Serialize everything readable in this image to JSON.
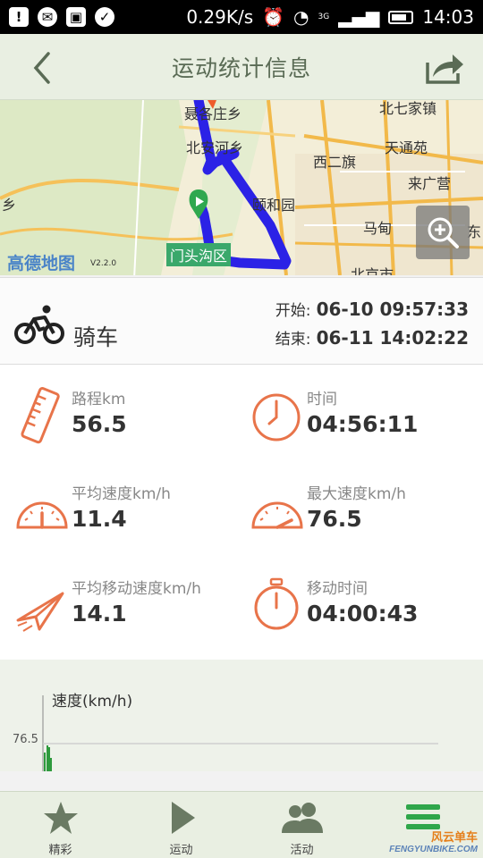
{
  "status_bar": {
    "speed": "0.29K/s",
    "network": "3G",
    "clock": "14:03"
  },
  "header": {
    "title": "运动统计信息",
    "back_icon": "chevron-left-icon",
    "share_icon": "share-icon"
  },
  "map": {
    "labels": [
      "聂各庄乡",
      "北安河乡",
      "西二旗",
      "天通苑",
      "来广营",
      "颐和园",
      "马甸",
      "北七家镇",
      "东",
      "乡",
      "北京市"
    ],
    "district_badge": "门头沟区",
    "provider": "高德地图",
    "provider_version": "V2.2.0",
    "route_color": "#2b22e6"
  },
  "activity": {
    "type": "骑车",
    "start_label": "开始:",
    "start_time": "06-10 09:57:33",
    "end_label": "结束:",
    "end_time": "06-11 14:02:22"
  },
  "stats": {
    "distance": {
      "label": "路程km",
      "value": "56.5"
    },
    "duration": {
      "label": "时间",
      "value": "04:56:11"
    },
    "avg_speed": {
      "label": "平均速度km/h",
      "value": "11.4"
    },
    "max_speed": {
      "label": "最大速度km/h",
      "value": "76.5"
    },
    "avg_moving_speed": {
      "label": "平均移动速度km/h",
      "value": "14.1"
    },
    "moving_time": {
      "label": "移动时间",
      "value": "04:00:43"
    }
  },
  "chart": {
    "ylabel": "速度(km/h)",
    "ref_tick": "76.5"
  },
  "tabs": [
    {
      "label": "精彩",
      "icon": "star-icon"
    },
    {
      "label": "运动",
      "icon": "play-icon"
    },
    {
      "label": "活动",
      "icon": "people-icon"
    },
    {
      "label": "",
      "icon": "menu-icon"
    }
  ],
  "watermark": {
    "cn": "风云单车",
    "en": "FENGYUNBIKE.COM"
  },
  "colors": {
    "accent": "#e8744a",
    "header_bg": "#e9efe2",
    "chart_bar": "#2e9a3d"
  }
}
